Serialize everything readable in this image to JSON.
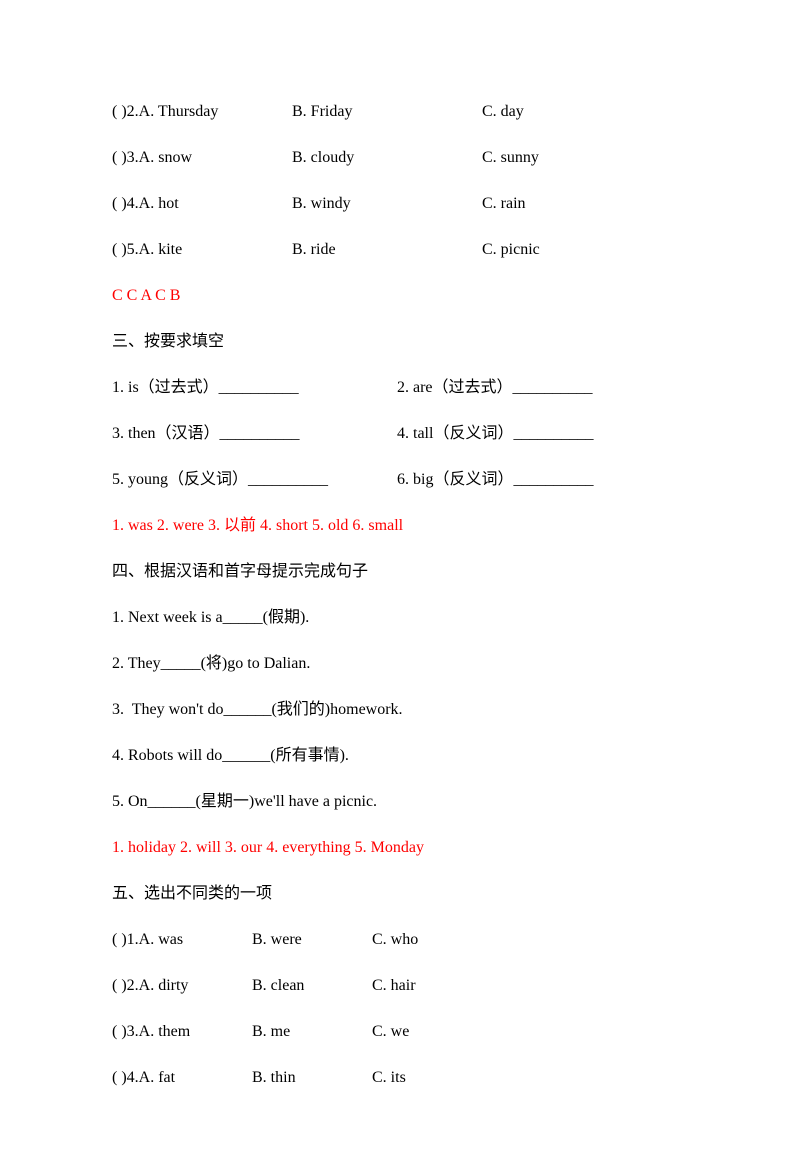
{
  "section2": {
    "rows": [
      {
        "num": "( )2.",
        "a": "A. Thursday",
        "b": "B. Friday",
        "c": "C. day"
      },
      {
        "num": "( )3.",
        "a": "A. snow",
        "b": "B. cloudy",
        "c": "C. sunny"
      },
      {
        "num": "( )4.",
        "a": "A. hot",
        "b": "B. windy",
        "c": "C. rain"
      },
      {
        "num": "( )5.",
        "a": "A. kite",
        "b": "B. ride",
        "c": "C. picnic"
      }
    ],
    "answer": "C C A C B"
  },
  "section3": {
    "title": "三、按要求填空",
    "items": [
      {
        "l": "1. is（过去式）__________",
        "r": "2. are（过去式）__________"
      },
      {
        "l": "3. then（汉语）__________",
        "r": "4. tall（反义词）__________"
      },
      {
        "l": "5. young（反义词）__________",
        "r": "6. big（反义词）__________"
      }
    ],
    "answer": "1. was 2. were 3. 以前 4. short 5. old 6. small"
  },
  "section4": {
    "title": "四、根据汉语和首字母提示完成句子",
    "items": [
      "1. Next week is a_____(假期).",
      "2. They_____(将)go to Dalian.",
      "3.  They won't do______(我们的)homework.",
      "4. Robots will do______(所有事情).",
      "5. On______(星期一)we'll have a picnic."
    ],
    "answer": "1. holiday 2. will 3. our 4. everything 5. Monday"
  },
  "section5": {
    "title": "五、选出不同类的一项",
    "rows": [
      {
        "num": "( )1.",
        "a": "A. was",
        "b": "B. were",
        "c": "C. who"
      },
      {
        "num": "( )2.",
        "a": "A. dirty",
        "b": "B. clean",
        "c": "C. hair"
      },
      {
        "num": "( )3.",
        "a": "A. them",
        "b": "B. me",
        "c": "C. we"
      },
      {
        "num": "( )4.",
        "a": "A. fat",
        "b": "B. thin",
        "c": "C. its"
      }
    ]
  }
}
